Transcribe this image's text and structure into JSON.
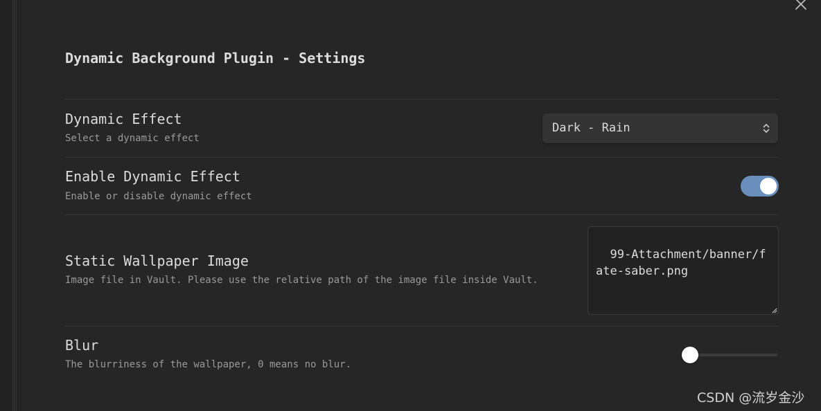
{
  "modal": {
    "title": "Dynamic Background Plugin - Settings",
    "close_icon": "close-icon"
  },
  "settings": {
    "dynamic_effect": {
      "name": "Dynamic Effect",
      "description": "Select a dynamic effect",
      "selected": "Dark - Rain",
      "icon": "chevron-up-down-icon"
    },
    "enable_effect": {
      "name": "Enable Dynamic Effect",
      "description": "Enable or disable dynamic effect",
      "enabled": true
    },
    "wallpaper": {
      "name": "Static Wallpaper Image",
      "description": "Image file in Vault. Please use the relative path of the image file inside Vault.",
      "value": "99-Attachment/banner/fate-saber.png"
    },
    "blur": {
      "name": "Blur",
      "description": "The blurriness of the wallpaper, 0 means no blur.",
      "value": 0
    }
  },
  "watermark": "CSDN @流岁金沙",
  "colors": {
    "background": "#262626",
    "toggle_on": "#6a8fbd",
    "text": "#dcdcdc",
    "muted_text": "#9a9a9a"
  }
}
